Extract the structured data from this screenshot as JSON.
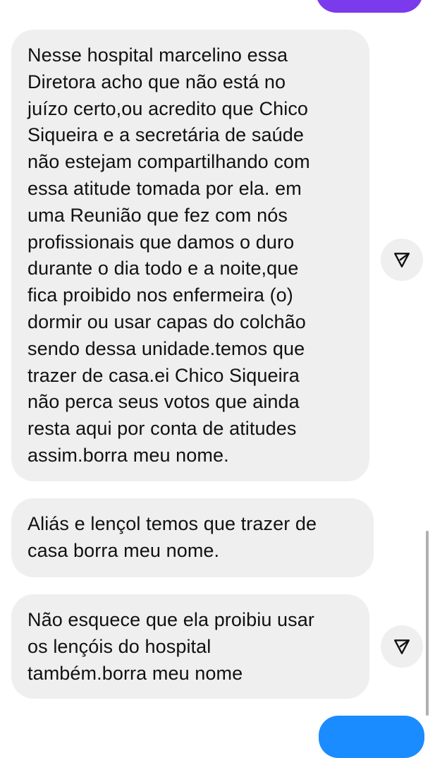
{
  "messages": [
    {
      "text": "Nesse hospital marcelino essa\nDiretora acho que não está no\njuízo certo,ou acredito que Chico\nSiqueira e a secretária de saúde\nnão estejam compartilhando com\nessa atitude tomada por ela. em\numa Reunião que fez com nós\nprofissionais que damos o duro\ndurante o dia todo e a noite,que\nfica proibido nos enfermeira (o)\ndormir ou usar capas do colchão\nsendo dessa unidade.temos que\ntrazer de casa.ei Chico Siqueira\nnão perca seus votos que ainda\nresta aqui por conta de atitudes\nassim.borra meu nome."
    },
    {
      "text": "Aliás e lençol temos que trazer de\ncasa borra meu nome."
    },
    {
      "text": "Não esquece que ela proibiu usar\nos lençóis do hospital\ntambém.borra meu nome"
    }
  ],
  "icons": {
    "share": "share-icon"
  },
  "colors": {
    "received_bubble": "#efefef",
    "sent_bubble_top": "#7c3aed",
    "sent_bubble_bottom": "#1a8cff",
    "text": "#111111"
  }
}
